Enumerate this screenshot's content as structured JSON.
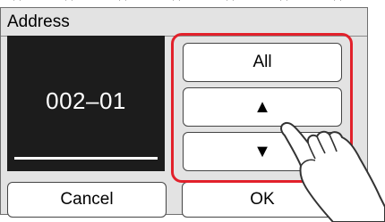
{
  "title": "Address",
  "display": {
    "value": "002–01"
  },
  "buttons": {
    "all_label": "All",
    "up_label": "▲",
    "down_label": "▼",
    "cancel_label": "Cancel",
    "ok_label": "OK"
  },
  "icons": {
    "up": "up-arrow-icon",
    "down": "down-arrow-icon",
    "pointer": "hand-pointer-icon"
  },
  "colors": {
    "highlight": "#e2212b",
    "display_bg": "#1c1c1c",
    "panel_bg": "#e3e3e3"
  }
}
